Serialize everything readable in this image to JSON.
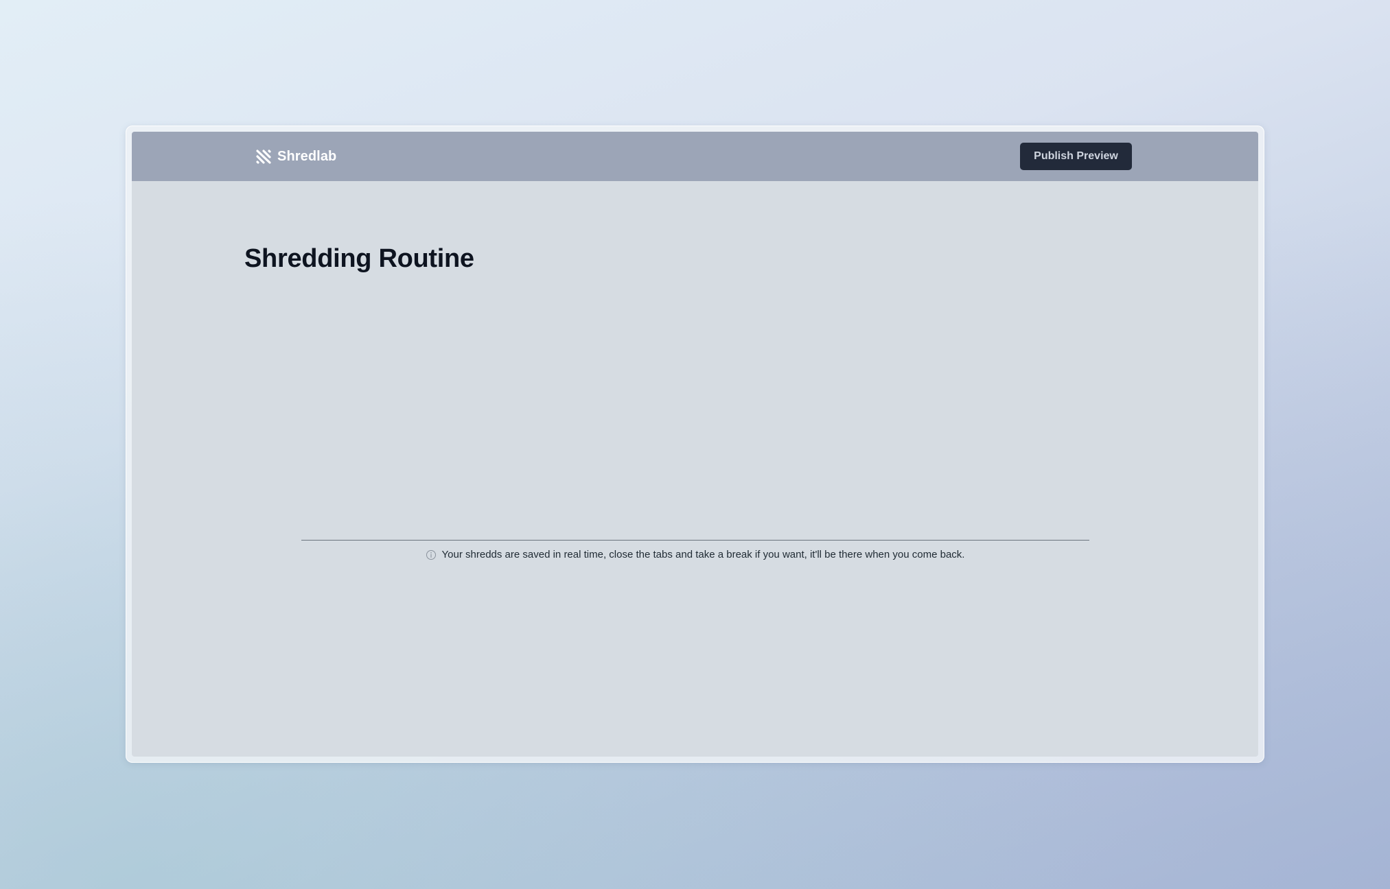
{
  "app": {
    "brand_name": "Shredlab",
    "brand_icon": "shredlab-logo-icon"
  },
  "header": {
    "publish_label": "Publish Preview"
  },
  "main": {
    "title": "Shredding Routine",
    "notice_icon": "info-icon",
    "notice_text": "Your shredds are saved in real time, close the tabs and take a break if you want, it'll be there when you come back."
  },
  "colors": {
    "topbar": "#9ca5b7",
    "publish_button": "#222a3a",
    "content_background": "#d6dce2"
  }
}
